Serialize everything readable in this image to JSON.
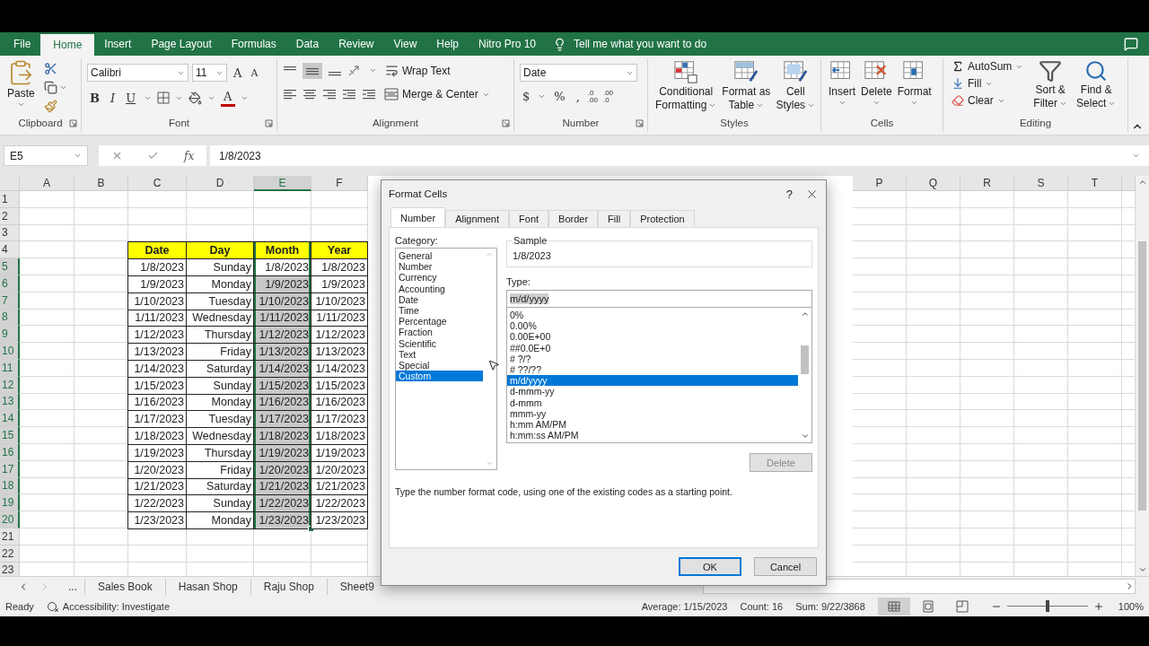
{
  "tabs": [
    {
      "label": "File",
      "selected": false
    },
    {
      "label": "Home",
      "selected": true
    },
    {
      "label": "Insert",
      "selected": false
    },
    {
      "label": "Page Layout",
      "selected": false
    },
    {
      "label": "Formulas",
      "selected": false
    },
    {
      "label": "Data",
      "selected": false
    },
    {
      "label": "Review",
      "selected": false
    },
    {
      "label": "View",
      "selected": false
    },
    {
      "label": "Help",
      "selected": false
    },
    {
      "label": "Nitro Pro 10",
      "selected": false
    }
  ],
  "tell_me": "Tell me what you want to do",
  "ribbon": [
    {
      "kind": "clipboard",
      "label": "Clipboard",
      "paste": "Paste"
    },
    {
      "kind": "font",
      "label": "Font",
      "font_name": "Calibri",
      "font_size": "11",
      "grow": "A",
      "shrink": "A",
      "bold": "B",
      "italic": "I",
      "underline": "U",
      "font_color": "A"
    },
    {
      "kind": "alignment",
      "label": "Alignment",
      "wrap": "Wrap Text",
      "merge": "Merge & Center"
    },
    {
      "kind": "number",
      "label": "Number",
      "format": "Date",
      "currency": "$",
      "percent": "%",
      "comma": ",",
      "increase_decimal": [
        ".0",
        ".00"
      ],
      "decrease_decimal": [
        ".00",
        ".0"
      ]
    },
    {
      "kind": "styles",
      "label": "Styles",
      "buttons": [
        {
          "kind": "conditional",
          "lines": [
            "Conditional",
            "Formatting"
          ]
        },
        {
          "kind": "table",
          "lines": [
            "Format as",
            "Table"
          ]
        },
        {
          "kind": "cell-styles",
          "lines": [
            "Cell",
            "Styles"
          ]
        }
      ]
    },
    {
      "kind": "cells",
      "label": "Cells",
      "buttons": [
        {
          "kind": "insert",
          "label": "Insert"
        },
        {
          "kind": "delete",
          "label": "Delete"
        },
        {
          "kind": "format",
          "label": "Format"
        }
      ]
    },
    {
      "kind": "editing",
      "label": "Editing",
      "autosum": "AutoSum",
      "fill": "Fill",
      "clear": "Clear",
      "buttons": [
        {
          "kind": "sort",
          "lines": [
            "Sort &",
            "Filter"
          ]
        },
        {
          "kind": "find",
          "lines": [
            "Find &",
            "Select"
          ]
        }
      ]
    }
  ],
  "formula_bar": {
    "name_box": "E5",
    "function_label": "fx",
    "value": "1/8/2023"
  },
  "sheet": {
    "left_columns": [
      {
        "label": "A",
        "selected": false
      },
      {
        "label": "B",
        "selected": false
      },
      {
        "label": "C",
        "selected": false
      },
      {
        "label": "D",
        "selected": false
      },
      {
        "label": "E",
        "selected": true
      },
      {
        "label": "F",
        "selected": false
      }
    ],
    "right_columns": [
      {
        "label": "P",
        "selected": false
      },
      {
        "label": "Q",
        "selected": false
      },
      {
        "label": "R",
        "selected": false
      },
      {
        "label": "S",
        "selected": false
      },
      {
        "label": "T",
        "selected": false
      }
    ],
    "row_numbers": [
      {
        "label": "1",
        "selected": false
      },
      {
        "label": "2",
        "selected": false
      },
      {
        "label": "3",
        "selected": false
      },
      {
        "label": "4",
        "selected": false
      },
      {
        "label": "5",
        "selected": true
      },
      {
        "label": "6",
        "selected": true
      },
      {
        "label": "7",
        "selected": true
      },
      {
        "label": "8",
        "selected": true
      },
      {
        "label": "9",
        "selected": true
      },
      {
        "label": "10",
        "selected": true
      },
      {
        "label": "11",
        "selected": true
      },
      {
        "label": "12",
        "selected": true
      },
      {
        "label": "13",
        "selected": true
      },
      {
        "label": "14",
        "selected": true
      },
      {
        "label": "15",
        "selected": true
      },
      {
        "label": "16",
        "selected": true
      },
      {
        "label": "17",
        "selected": true
      },
      {
        "label": "18",
        "selected": true
      },
      {
        "label": "19",
        "selected": true
      },
      {
        "label": "20",
        "selected": true
      },
      {
        "label": "21",
        "selected": false
      },
      {
        "label": "22",
        "selected": false
      },
      {
        "label": "23",
        "selected": false
      }
    ],
    "table": {
      "header": [
        {
          "text": "Date",
          "selected": false
        },
        {
          "text": "Day",
          "selected": false
        },
        {
          "text": "Month",
          "selected": true
        },
        {
          "text": "Year",
          "selected": false
        }
      ],
      "rows": [
        {
          "active": true,
          "cells": [
            "1/8/2023",
            "Sunday",
            "1/8/2023",
            "1/8/2023"
          ]
        },
        {
          "active": false,
          "cells": [
            "1/9/2023",
            "Monday",
            "1/9/2023",
            "1/9/2023"
          ]
        },
        {
          "active": false,
          "cells": [
            "1/10/2023",
            "Tuesday",
            "1/10/2023",
            "1/10/2023"
          ]
        },
        {
          "active": false,
          "cells": [
            "1/11/2023",
            "Wednesday",
            "1/11/2023",
            "1/11/2023"
          ]
        },
        {
          "active": false,
          "cells": [
            "1/12/2023",
            "Thursday",
            "1/12/2023",
            "1/12/2023"
          ]
        },
        {
          "active": false,
          "cells": [
            "1/13/2023",
            "Friday",
            "1/13/2023",
            "1/13/2023"
          ]
        },
        {
          "active": false,
          "cells": [
            "1/14/2023",
            "Saturday",
            "1/14/2023",
            "1/14/2023"
          ]
        },
        {
          "active": false,
          "cells": [
            "1/15/2023",
            "Sunday",
            "1/15/2023",
            "1/15/2023"
          ]
        },
        {
          "active": false,
          "cells": [
            "1/16/2023",
            "Monday",
            "1/16/2023",
            "1/16/2023"
          ]
        },
        {
          "active": false,
          "cells": [
            "1/17/2023",
            "Tuesday",
            "1/17/2023",
            "1/17/2023"
          ]
        },
        {
          "active": false,
          "cells": [
            "1/18/2023",
            "Wednesday",
            "1/18/2023",
            "1/18/2023"
          ]
        },
        {
          "active": false,
          "cells": [
            "1/19/2023",
            "Thursday",
            "1/19/2023",
            "1/19/2023"
          ]
        },
        {
          "active": false,
          "cells": [
            "1/20/2023",
            "Friday",
            "1/20/2023",
            "1/20/2023"
          ]
        },
        {
          "active": false,
          "cells": [
            "1/21/2023",
            "Saturday",
            "1/21/2023",
            "1/21/2023"
          ]
        },
        {
          "active": false,
          "cells": [
            "1/22/2023",
            "Sunday",
            "1/22/2023",
            "1/22/2023"
          ]
        },
        {
          "active": false,
          "cells": [
            "1/23/2023",
            "Monday",
            "1/23/2023",
            "1/23/2023"
          ]
        }
      ]
    }
  },
  "dialog": {
    "title": "Format Cells",
    "help": "?",
    "tabs": [
      {
        "label": "Number",
        "selected": true
      },
      {
        "label": "Alignment",
        "selected": false
      },
      {
        "label": "Font",
        "selected": false
      },
      {
        "label": "Border",
        "selected": false
      },
      {
        "label": "Fill",
        "selected": false
      },
      {
        "label": "Protection",
        "selected": false
      }
    ],
    "category_label": "Category:",
    "categories": [
      {
        "label": "General",
        "selected": false
      },
      {
        "label": "Number",
        "selected": false
      },
      {
        "label": "Currency",
        "selected": false
      },
      {
        "label": "Accounting",
        "selected": false
      },
      {
        "label": "Date",
        "selected": false
      },
      {
        "label": "Time",
        "selected": false
      },
      {
        "label": "Percentage",
        "selected": false
      },
      {
        "label": "Fraction",
        "selected": false
      },
      {
        "label": "Scientific",
        "selected": false
      },
      {
        "label": "Text",
        "selected": false
      },
      {
        "label": "Special",
        "selected": false
      },
      {
        "label": "Custom",
        "selected": true
      }
    ],
    "sample_label": "Sample",
    "sample": "1/8/2023",
    "type_label": "Type:",
    "type_value": "m/d/yyyy",
    "types": [
      {
        "label": "0%",
        "selected": false
      },
      {
        "label": "0.00%",
        "selected": false
      },
      {
        "label": "0.00E+00",
        "selected": false
      },
      {
        "label": "##0.0E+0",
        "selected": false
      },
      {
        "label": "# ?/?",
        "selected": false
      },
      {
        "label": "# ??/??",
        "selected": false
      },
      {
        "label": "m/d/yyyy",
        "selected": true
      },
      {
        "label": "d-mmm-yy",
        "selected": false
      },
      {
        "label": "d-mmm",
        "selected": false
      },
      {
        "label": "mmm-yy",
        "selected": false
      },
      {
        "label": "h:mm AM/PM",
        "selected": false
      },
      {
        "label": "h:mm:ss AM/PM",
        "selected": false
      }
    ],
    "delete": {
      "label": "Delete",
      "disabled": true
    },
    "hint": "Type the number format code, using one of the existing codes as a starting point.",
    "ok": "OK",
    "cancel": "Cancel"
  },
  "sheet_tabs": {
    "more": "...",
    "tabs": [
      {
        "label": "Sales Book",
        "selected": false
      },
      {
        "label": "Hasan Shop",
        "selected": false
      },
      {
        "label": "Raju Shop",
        "selected": false
      },
      {
        "label": "Sheet9",
        "selected": false
      }
    ]
  },
  "status_bar": {
    "ready": "Ready",
    "accessibility": "Accessibility: Investigate",
    "average": "Average: 1/15/2023",
    "count": "Count: 16",
    "sum": "Sum: 9/22/3868",
    "views": [
      {
        "kind": "normal",
        "selected": true
      },
      {
        "kind": "page-layout",
        "selected": false
      },
      {
        "kind": "page-break",
        "selected": false
      }
    ],
    "zoom": {
      "level": 0.5,
      "reading": "100%"
    }
  }
}
